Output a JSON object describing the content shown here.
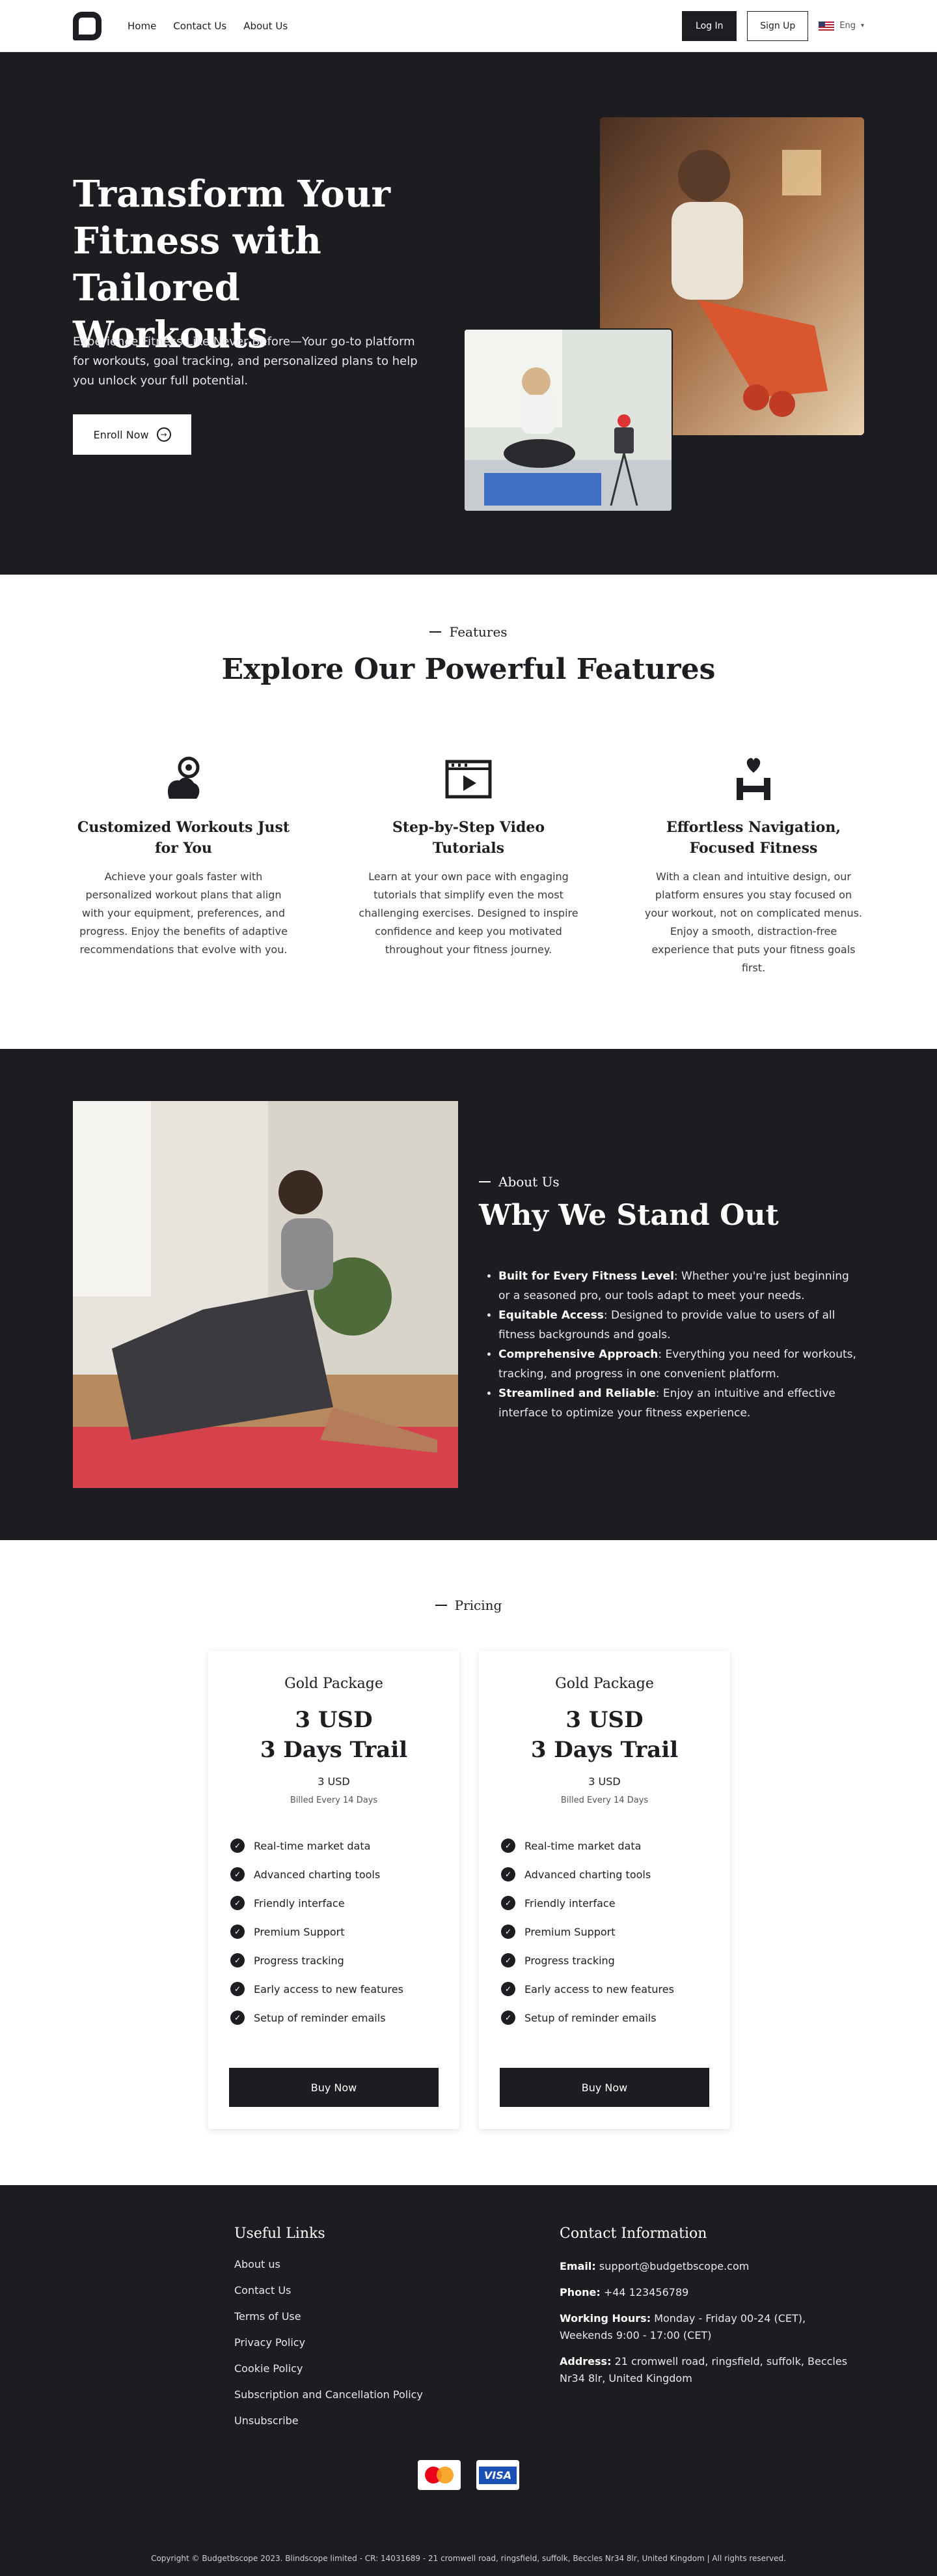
{
  "header": {
    "nav": [
      "Home",
      "Contact Us",
      "About Us"
    ],
    "login": "Log In",
    "signup": "Sign Up",
    "lang": "Eng"
  },
  "hero": {
    "title": "Transform Your Fitness with Tailored Workouts",
    "description": "Experience Fitness Like Never Before—Your go-to platform for workouts, goal tracking, and personalized plans to help you unlock your full potential.",
    "cta": "Enroll Now"
  },
  "features": {
    "eyebrow": "Features",
    "title": "Explore Our Powerful Features",
    "items": [
      {
        "title": "Customized Workouts Just for You",
        "text": "Achieve your goals faster with personalized workout plans that align with your equipment, preferences, and progress. Enjoy the benefits of adaptive recommendations that evolve with you."
      },
      {
        "title": "Step-by-Step Video Tutorials",
        "text": "Learn at your own pace with engaging tutorials that simplify even the most challenging exercises. Designed to inspire confidence and keep you motivated throughout your fitness journey."
      },
      {
        "title": "Effortless Navigation, Focused Fitness",
        "text": "With a clean and intuitive design, our platform ensures you stay focused on your workout, not on complicated menus. Enjoy a smooth, distraction-free experience that puts your fitness goals first."
      }
    ]
  },
  "about": {
    "eyebrow": "About Us",
    "title": "Why We Stand Out",
    "points": [
      {
        "bold": "Built for Every Fitness Level",
        "text": ": Whether you're just beginning or a seasoned pro, our tools adapt to meet your needs."
      },
      {
        "bold": "Equitable Access",
        "text": ": Designed to provide value to users of all fitness backgrounds and goals."
      },
      {
        "bold": "Comprehensive Approach",
        "text": ": Everything you need for workouts, tracking, and progress in one convenient platform."
      },
      {
        "bold": "Streamlined and Reliable",
        "text": ": Enjoy an intuitive and effective interface to optimize your fitness experience."
      }
    ]
  },
  "pricing": {
    "eyebrow": "Pricing",
    "cards": [
      {
        "name": "Gold Package",
        "price": "3 USD",
        "trial": "3 Days Trail",
        "small_price": "3 USD",
        "billed": "Billed Every 14 Days",
        "features": [
          "Real-time market data",
          "Advanced charting tools",
          "Friendly interface",
          "Premium Support",
          "Progress tracking",
          "Early access to new features",
          "Setup of reminder emails"
        ],
        "button": "Buy Now"
      },
      {
        "name": "Gold Package",
        "price": "3 USD",
        "trial": "3 Days Trail",
        "small_price": "3 USD",
        "billed": "Billed Every 14 Days",
        "features": [
          "Real-time market data",
          "Advanced charting tools",
          "Friendly interface",
          "Premium Support",
          "Progress tracking",
          "Early access to new features",
          "Setup of reminder emails"
        ],
        "button": "Buy Now"
      }
    ]
  },
  "footer": {
    "links_title": "Useful Links",
    "links": [
      "About us",
      "Contact Us",
      "Terms of Use",
      "Privacy Policy",
      "Cookie Policy",
      "Subscription and Cancellation Policy",
      "Unsubscribe"
    ],
    "contact_title": "Contact Information",
    "email_label": "Email:",
    "email": "support@budgetbscope.com",
    "phone_label": "Phone:",
    "phone": "+44 123456789",
    "hours_label": "Working Hours:",
    "hours": "Monday - Friday 00-24 (CET), Weekends 9:00 - 17:00 (CET)",
    "address_label": "Address:",
    "address": "21 cromwell road, ringsfield, suffolk, Beccles Nr34 8lr, United Kingdom",
    "visa": "VISA",
    "copyright": "Copyright © Budgetbscope 2023. Blindscope limited - CR: 14031689 - 21 cromwell road, ringsfield, suffolk, Beccles Nr34 8lr, United Kingdom | All rights reserved."
  },
  "colors": {
    "dark": "#1c1c21",
    "accent": "#1d1d22"
  }
}
